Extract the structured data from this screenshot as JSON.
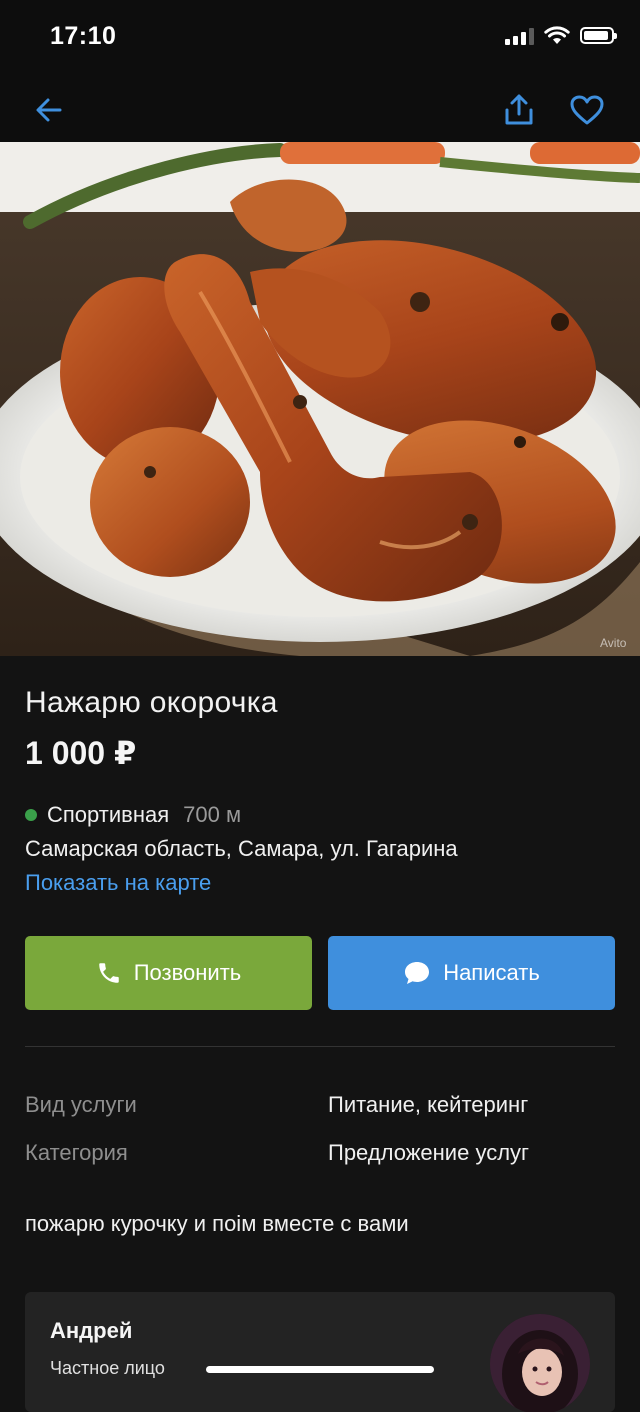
{
  "status_bar": {
    "time": "17:10"
  },
  "nav": {
    "back_icon": "arrow-left-icon",
    "share_icon": "share-icon",
    "favorite_icon": "heart-icon"
  },
  "listing": {
    "title": "Нажарю окорочка",
    "price": "1 000 ₽",
    "metro_station": "Спортивная",
    "metro_distance": "700 м",
    "address": "Самарская область, Самара, ул. Гагарина",
    "map_link": "Показать на карте",
    "photo_watermark": "Avito",
    "description": "пожарю курочку и поім вместе с вами"
  },
  "actions": {
    "call_label": "Позвонить",
    "write_label": "Написать"
  },
  "params": [
    {
      "label": "Вид услуги",
      "value": "Питание, кейтеринг"
    },
    {
      "label": "Категория",
      "value": "Предложение услуг"
    }
  ],
  "seller": {
    "name": "Андрей",
    "type": "Частное лицо"
  },
  "colors": {
    "background": "#131313",
    "accent_blue": "#3f8fdd",
    "link_blue": "#4a9eee",
    "call_green": "#7aa83b",
    "metro_green": "#3aa04a"
  }
}
